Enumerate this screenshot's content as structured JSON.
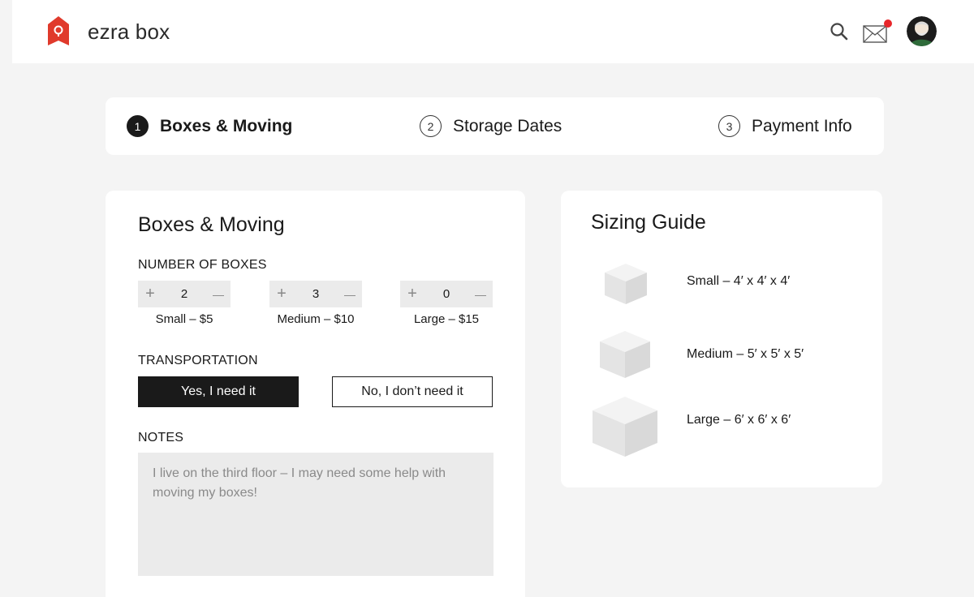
{
  "header": {
    "brand": "ezra box",
    "icons": {
      "logo": "house-logo-icon",
      "search": "search-icon",
      "mail": "mail-icon",
      "avatar": "user-avatar"
    },
    "colors": {
      "brand_red": "#e03a2c",
      "notification": "#e8262a"
    }
  },
  "stepper": {
    "steps": [
      {
        "num": "1",
        "label": "Boxes & Moving",
        "active": true
      },
      {
        "num": "2",
        "label": "Storage Dates",
        "active": false
      },
      {
        "num": "3",
        "label": "Payment Info",
        "active": false
      }
    ]
  },
  "boxes_card": {
    "title": "Boxes & Moving",
    "number_label": "NUMBER OF BOXES",
    "boxes": [
      {
        "plus": "+",
        "value": "2",
        "minus": "—",
        "label": "Small – $5"
      },
      {
        "plus": "+",
        "value": "3",
        "minus": "—",
        "label": "Medium – $10"
      },
      {
        "plus": "+",
        "value": "0",
        "minus": "—",
        "label": "Large – $15"
      }
    ],
    "transportation_label": "TRANSPORTATION",
    "yes_label": "Yes, I need it",
    "no_label": "No, I don’t need it",
    "notes_label": "NOTES",
    "notes_value": "I live on the third floor – I may need some help with moving my boxes!"
  },
  "sizing_guide": {
    "title": "Sizing Guide",
    "items": [
      {
        "label": "Small – 4′ x 4′ x 4′"
      },
      {
        "label": "Medium – 5′ x 5′ x 5′"
      },
      {
        "label": "Large – 6′ x 6′ x 6′"
      }
    ]
  }
}
